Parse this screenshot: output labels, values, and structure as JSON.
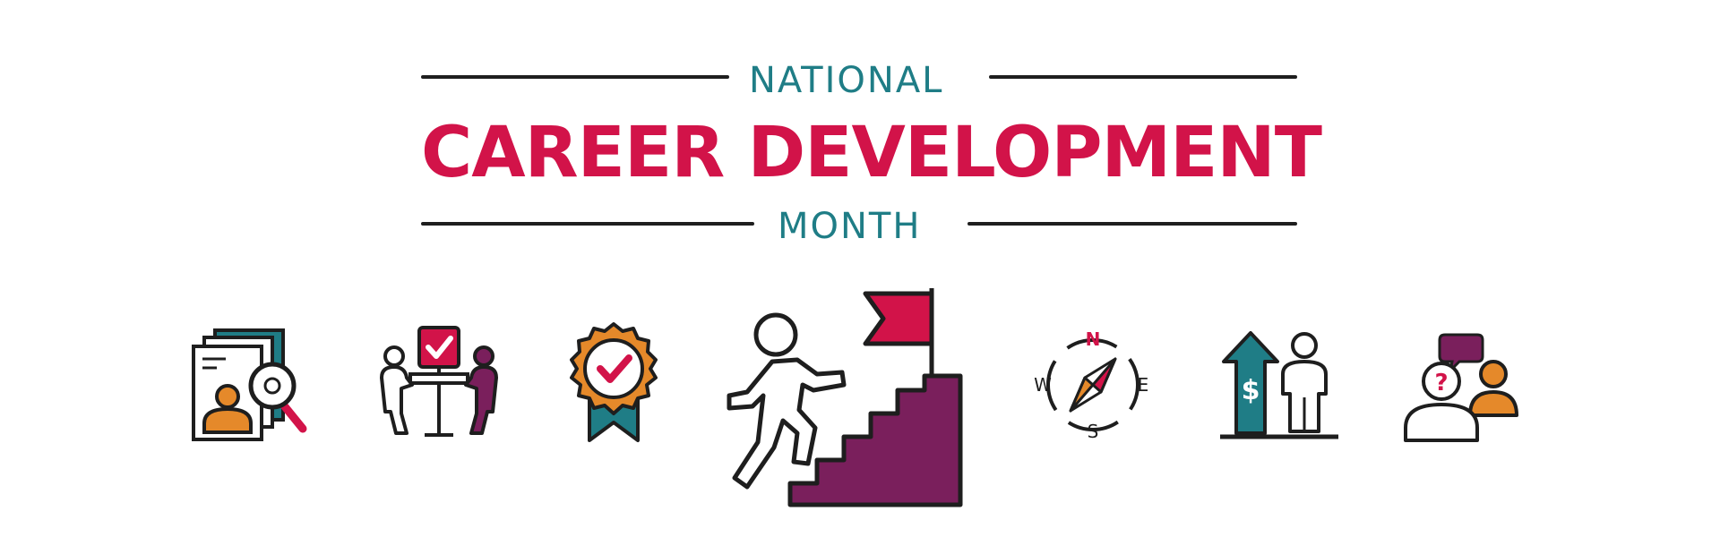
{
  "banner": {
    "title_top": "NATIONAL",
    "title_main": "CAREER DEVELOPMENT",
    "title_bottom": "MONTH"
  },
  "icons": [
    {
      "name": "job-search-resume-icon"
    },
    {
      "name": "interview-meeting-icon"
    },
    {
      "name": "award-badge-icon"
    },
    {
      "name": "climbing-stairs-flag-icon"
    },
    {
      "name": "compass-icon"
    },
    {
      "name": "salary-growth-icon"
    },
    {
      "name": "career-question-icon"
    }
  ],
  "compass_letters": {
    "north": "N",
    "south": "S",
    "east": "E",
    "west": "W"
  },
  "salary_symbol": "$",
  "question_symbol": "?",
  "colors": {
    "red": "#d21349",
    "teal": "#1f7d86",
    "teal_dark": "#176970",
    "purple": "#7a1f5c",
    "orange": "#e5892a",
    "outline": "#1e1e1e"
  }
}
